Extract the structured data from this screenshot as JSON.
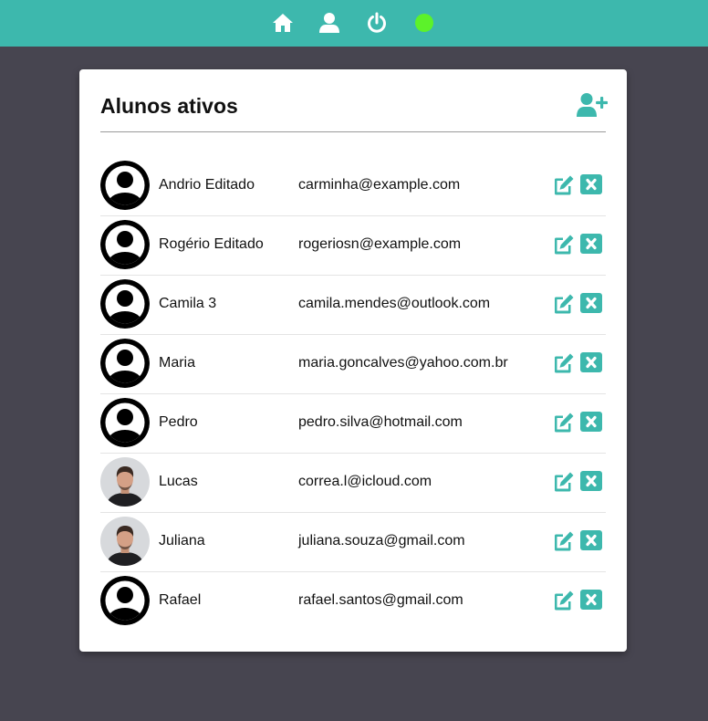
{
  "colors": {
    "topbar": "#3db8ad",
    "accent": "#3db8ad",
    "background": "#474550",
    "card": "#ffffff",
    "status_online": "#5cf22a"
  },
  "nav": {
    "icons": [
      "home-icon",
      "user-icon",
      "power-icon"
    ],
    "status": "online"
  },
  "page": {
    "title": "Alunos ativos",
    "add_icon": "user-plus-icon"
  },
  "students": [
    {
      "name": "Andrio Editado",
      "email": "carminha@example.com",
      "avatar": "default"
    },
    {
      "name": "Rogério Editado",
      "email": "rogeriosn@example.com",
      "avatar": "default"
    },
    {
      "name": "Camila 3",
      "email": "camila.mendes@outlook.com",
      "avatar": "default"
    },
    {
      "name": "Maria",
      "email": "maria.goncalves@yahoo.com.br",
      "avatar": "default"
    },
    {
      "name": "Pedro",
      "email": "pedro.silva@hotmail.com",
      "avatar": "default"
    },
    {
      "name": "Lucas",
      "email": "correa.l@icloud.com",
      "avatar": "photo"
    },
    {
      "name": "Juliana",
      "email": "juliana.souza@gmail.com",
      "avatar": "photo"
    },
    {
      "name": "Rafael",
      "email": "rafael.santos@gmail.com",
      "avatar": "default"
    }
  ],
  "row_actions": [
    "edit-icon",
    "delete-icon"
  ]
}
